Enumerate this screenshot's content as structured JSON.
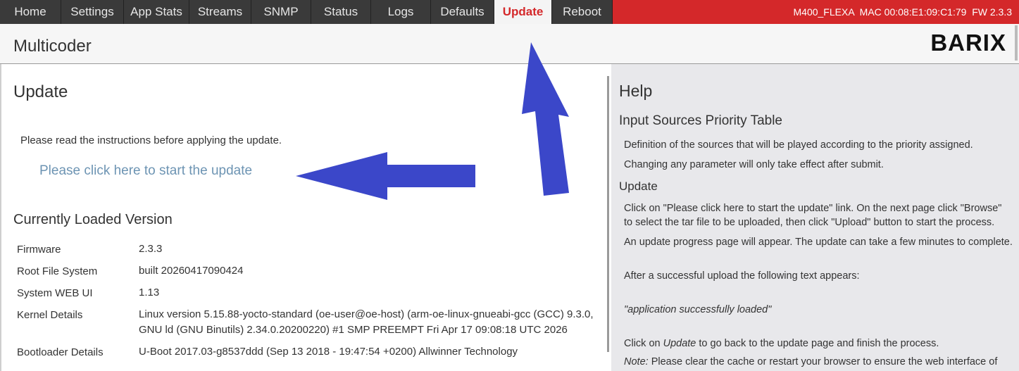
{
  "nav": {
    "tabs": [
      {
        "label": "Home",
        "active": false
      },
      {
        "label": "Settings",
        "active": false
      },
      {
        "label": "App Stats",
        "active": false
      },
      {
        "label": "Streams",
        "active": false
      },
      {
        "label": "SNMP",
        "active": false
      },
      {
        "label": "Status",
        "active": false
      },
      {
        "label": "Logs",
        "active": false
      },
      {
        "label": "Defaults",
        "active": false
      },
      {
        "label": "Update",
        "active": true
      },
      {
        "label": "Reboot",
        "active": false
      }
    ],
    "device_info": "M400_FLEXA  MAC 00:08:E1:09:C1:79  FW 2.3.3"
  },
  "header": {
    "title": "Multicoder",
    "logo": "BARIX"
  },
  "main": {
    "heading": "Update",
    "instructions": "Please read the instructions before applying the update.",
    "start_link": "Please click here to start the update",
    "loaded_heading": "Currently Loaded Version",
    "versions": [
      {
        "label": "Firmware",
        "value": "2.3.3"
      },
      {
        "label": "Root File System",
        "value": "built 20260417090424"
      },
      {
        "label": "System WEB UI",
        "value": "1.13"
      },
      {
        "label": "Kernel Details",
        "value": "Linux version 5.15.88-yocto-standard (oe-user@oe-host) (arm-oe-linux-gnueabi-gcc (GCC) 9.3.0, GNU ld (GNU Binutils) 2.34.0.20200220) #1 SMP PREEMPT Fri Apr 17 09:08:18 UTC 2026"
      },
      {
        "label": "Bootloader Details",
        "value": "U-Boot 2017.03-g8537ddd (Sep 13 2018 - 19:47:54 +0200) Allwinner Technology"
      }
    ]
  },
  "help": {
    "title": "Help",
    "section1_title": "Input Sources Priority Table",
    "section1_p1": "Definition of the sources that will be played according to the priority assigned.",
    "section1_p2": "Changing any parameter will only take effect after submit.",
    "section2_title": "Update",
    "section2_p1": "Click on \"Please click here to start the update\" link. On the next page click \"Browse\" to select the tar file to be uploaded, then click \"Upload\" button to start the process.",
    "section2_p2": "An update progress page will appear. The update can take a few minutes to complete.",
    "section2_p3": "After a successful upload the following text appears:",
    "section2_quote": "\"application successfully loaded\"",
    "section2_p4_pre": "Click on ",
    "section2_p4_em": "Update",
    "section2_p4_post": " to go back to the update page and finish the process.",
    "section2_note_em": "Note:",
    "section2_note_post": " Please clear the cache or restart your browser to ensure the web interface of"
  },
  "colors": {
    "accent": "#d4282a",
    "nav_bg": "#3a3a3a",
    "link": "#6d94b3",
    "arrow": "#3b47c9"
  }
}
